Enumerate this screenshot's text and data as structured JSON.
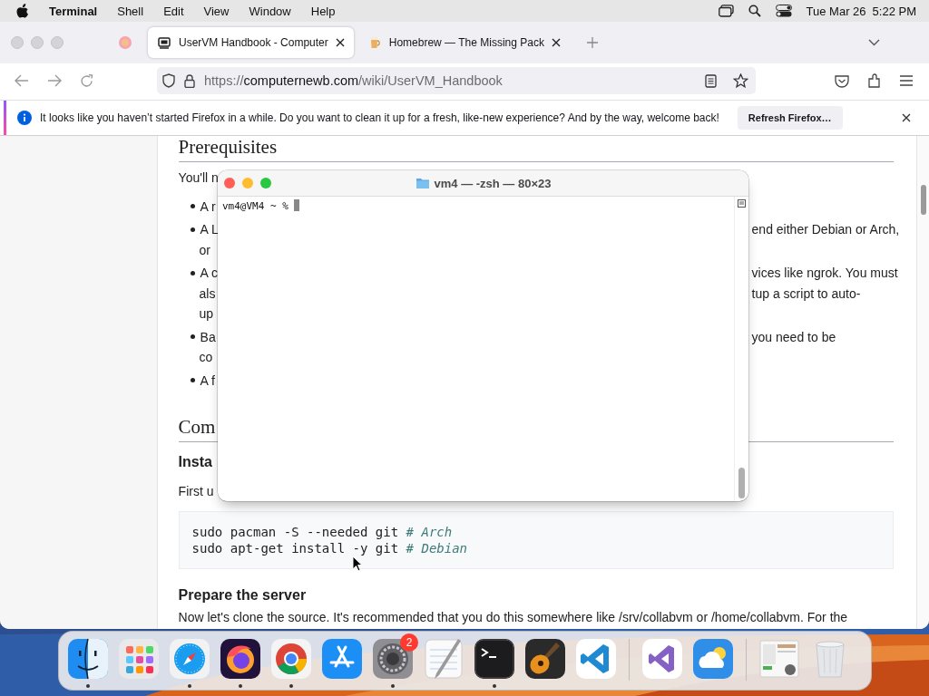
{
  "menubar": {
    "menus": [
      {
        "label": "Terminal",
        "kind": "app"
      },
      {
        "label": "Shell",
        "kind": "menu"
      },
      {
        "label": "Edit",
        "kind": "menu"
      },
      {
        "label": "View",
        "kind": "menu"
      },
      {
        "label": "Window",
        "kind": "menu"
      },
      {
        "label": "Help",
        "kind": "menu"
      }
    ],
    "date": "Tue Mar 26",
    "time": "5:22 PM"
  },
  "browser": {
    "tabs": [
      {
        "kind": "pinned",
        "selected": false
      },
      {
        "kind": "page",
        "label": "UserVM Handbook - Computer",
        "selected": true
      },
      {
        "kind": "page",
        "label": "Homebrew — The Missing Pack",
        "selected": false
      }
    ],
    "url": {
      "scheme": "https://",
      "host": "computernewb.com",
      "path": "/wiki/UserVM_Handbook"
    },
    "notification": {
      "message": "It looks like you haven’t started Firefox in a while. Do you want to clean it up for a fresh, like-new experience? And by the way, welcome back!",
      "button": "Refresh Firefox…"
    }
  },
  "article": [
    {
      "kind": "h2",
      "left": "Prerequisites"
    },
    {
      "kind": "para",
      "left": "You'll n"
    },
    {
      "kind": "bullet",
      "left": "A r"
    },
    {
      "kind": "bullet",
      "left": "A L",
      "right": "end either Debian or Arch,"
    },
    {
      "kind": "wrap",
      "left": "or"
    },
    {
      "kind": "bullet",
      "left": "A c",
      "right": "vices like ngrok. You must"
    },
    {
      "kind": "wrap",
      "left": "als",
      "right": "tup a script to auto-"
    },
    {
      "kind": "wrap",
      "left": "up"
    },
    {
      "kind": "bullet",
      "left": "Ba",
      "right": "you need to be"
    },
    {
      "kind": "wrap",
      "left": "co"
    },
    {
      "kind": "bullet",
      "left": "A f"
    },
    {
      "kind": "h2",
      "left": "Com"
    },
    {
      "kind": "h3",
      "left": "Insta"
    },
    {
      "kind": "para",
      "left": "First u"
    },
    {
      "kind": "code",
      "lines": [
        {
          "code": "sudo pacman -S --needed git ",
          "comment": "# Arch"
        },
        {
          "code": "sudo apt-get install -y git ",
          "comment": "# Debian"
        }
      ]
    },
    {
      "kind": "h3",
      "left": "Prepare the server"
    },
    {
      "kind": "para",
      "left": "Now let's clone the source. It's recommended that you do this somewhere like /srv/collabvm or /home/collabvm. For the"
    }
  ],
  "terminal": {
    "title": "vm4 — -zsh — 80×23",
    "prompt": "vm4@VM4 ~ % "
  },
  "dock": [
    {
      "kind": "finder",
      "running": true
    },
    {
      "kind": "launchpad",
      "running": false
    },
    {
      "kind": "safari",
      "running": true
    },
    {
      "kind": "firefox",
      "running": true
    },
    {
      "kind": "chrome",
      "running": true
    },
    {
      "kind": "appstore",
      "running": false
    },
    {
      "kind": "settings",
      "running": true,
      "badge": "2"
    },
    {
      "kind": "notes",
      "running": false
    },
    {
      "kind": "terminal",
      "running": true
    },
    {
      "kind": "guitar",
      "running": false
    },
    {
      "kind": "vscode",
      "running": false
    },
    {
      "kind": "separator"
    },
    {
      "kind": "vs",
      "running": false
    },
    {
      "kind": "weather",
      "running": false
    },
    {
      "kind": "separator"
    },
    {
      "kind": "thumbnail",
      "running": false
    },
    {
      "kind": "trash",
      "running": false
    }
  ]
}
